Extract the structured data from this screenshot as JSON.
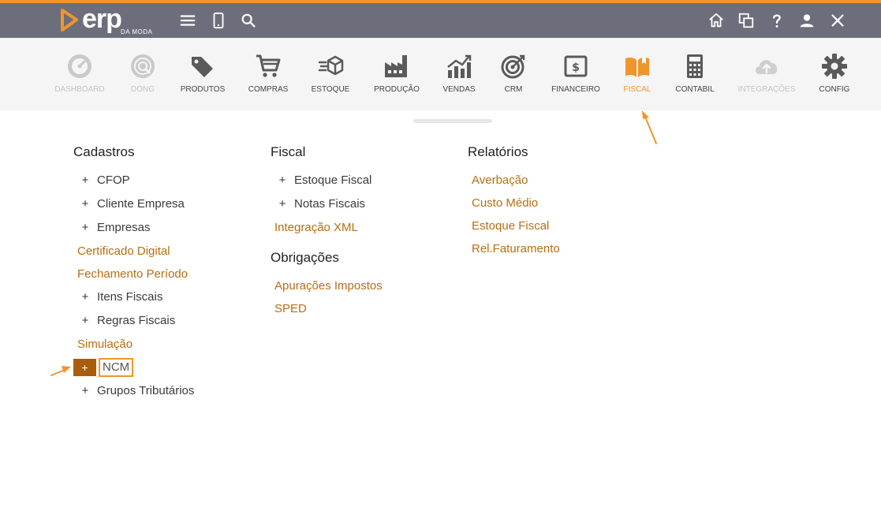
{
  "brand": {
    "name": "erp",
    "subtitle": "DA MODA",
    "accent": "#f0952c",
    "link_color": "#b86e12"
  },
  "topbar": {
    "left_icons": [
      "menu-icon",
      "mobile-icon",
      "search-icon"
    ],
    "right_icons": [
      "home-icon",
      "windows-icon",
      "help-icon",
      "user-icon",
      "close-icon"
    ]
  },
  "modules": [
    {
      "label": "DASHBOARD",
      "icon": "dashboard-icon",
      "state": "disabled"
    },
    {
      "label": "DONG",
      "icon": "dong-icon",
      "state": "disabled"
    },
    {
      "label": "PRODUTOS",
      "icon": "tags-icon",
      "state": "normal"
    },
    {
      "label": "COMPRAS",
      "icon": "cart-icon",
      "state": "normal"
    },
    {
      "label": "ESTOQUE",
      "icon": "box-icon",
      "state": "normal"
    },
    {
      "label": "PRODUÇÃO",
      "icon": "factory-icon",
      "state": "normal"
    },
    {
      "label": "VENDAS",
      "icon": "chart-icon",
      "state": "normal"
    },
    {
      "label": "CRM",
      "icon": "target-icon",
      "state": "normal"
    },
    {
      "label": "FINANCEIRO",
      "icon": "money-icon",
      "state": "normal"
    },
    {
      "label": "FISCAL",
      "icon": "book-icon",
      "state": "active"
    },
    {
      "label": "CONTABIL",
      "icon": "calculator-icon",
      "state": "normal"
    },
    {
      "label": "INTEGRAÇÕES",
      "icon": "cloud-upload-icon",
      "state": "disabled"
    },
    {
      "label": "CONFIG",
      "icon": "gear-icon",
      "state": "normal"
    }
  ],
  "menu": {
    "cadastros": {
      "title": "Cadastros",
      "items": [
        {
          "label": "CFOP",
          "expandable": true
        },
        {
          "label": "Cliente Empresa",
          "expandable": true
        },
        {
          "label": "Empresas",
          "expandable": true
        },
        {
          "label": "Certificado Digital",
          "expandable": false
        },
        {
          "label": "Fechamento Período",
          "expandable": false
        },
        {
          "label": "Itens Fiscais",
          "expandable": true
        },
        {
          "label": "Regras Fiscais",
          "expandable": true
        },
        {
          "label": "Simulação",
          "expandable": false
        },
        {
          "label": "NCM",
          "expandable": true,
          "highlighted": true
        },
        {
          "label": "Grupos Tributários",
          "expandable": true
        }
      ]
    },
    "fiscal": {
      "title": "Fiscal",
      "items": [
        {
          "label": "Estoque Fiscal",
          "expandable": true
        },
        {
          "label": "Notas Fiscais",
          "expandable": true
        },
        {
          "label": "Integração XML",
          "expandable": false
        }
      ]
    },
    "obrigacoes": {
      "title": "Obrigações",
      "items": [
        {
          "label": "Apurações Impostos",
          "expandable": false
        },
        {
          "label": "SPED",
          "expandable": false
        }
      ]
    },
    "relatorios": {
      "title": "Relatórios",
      "items": [
        {
          "label": "Averbação",
          "expandable": false
        },
        {
          "label": "Custo Médio",
          "expandable": false
        },
        {
          "label": "Estoque Fiscal",
          "expandable": false
        },
        {
          "label": "Rel.Faturamento",
          "expandable": false
        }
      ]
    }
  },
  "plus_symbol": "+"
}
